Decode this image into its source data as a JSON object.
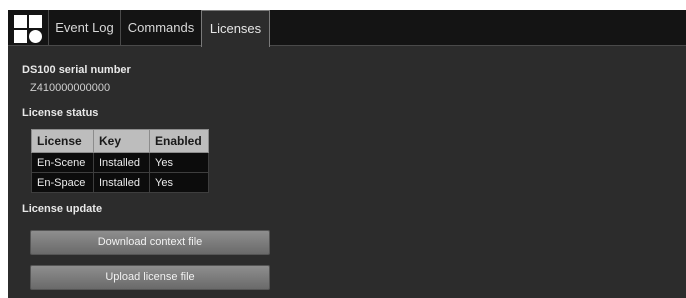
{
  "tabs": [
    {
      "label": "Event Log"
    },
    {
      "label": "Commands"
    },
    {
      "label": "Licenses"
    }
  ],
  "active_tab": "Licenses",
  "serial": {
    "heading": "DS100 serial number",
    "value": "Z410000000000"
  },
  "license_status": {
    "heading": "License status",
    "columns": [
      "License",
      "Key",
      "Enabled"
    ],
    "rows": [
      [
        "En-Scene",
        "Installed",
        "Yes"
      ],
      [
        "En-Space",
        "Installed",
        "Yes"
      ]
    ]
  },
  "license_update": {
    "heading": "License update",
    "download_label": "Download context file",
    "upload_label": "Upload license file"
  },
  "colors": {
    "background": "#2c2c2c",
    "topbar": "#141414",
    "table_header": "#bdbdbd",
    "table_cell": "#0c0c0c"
  }
}
